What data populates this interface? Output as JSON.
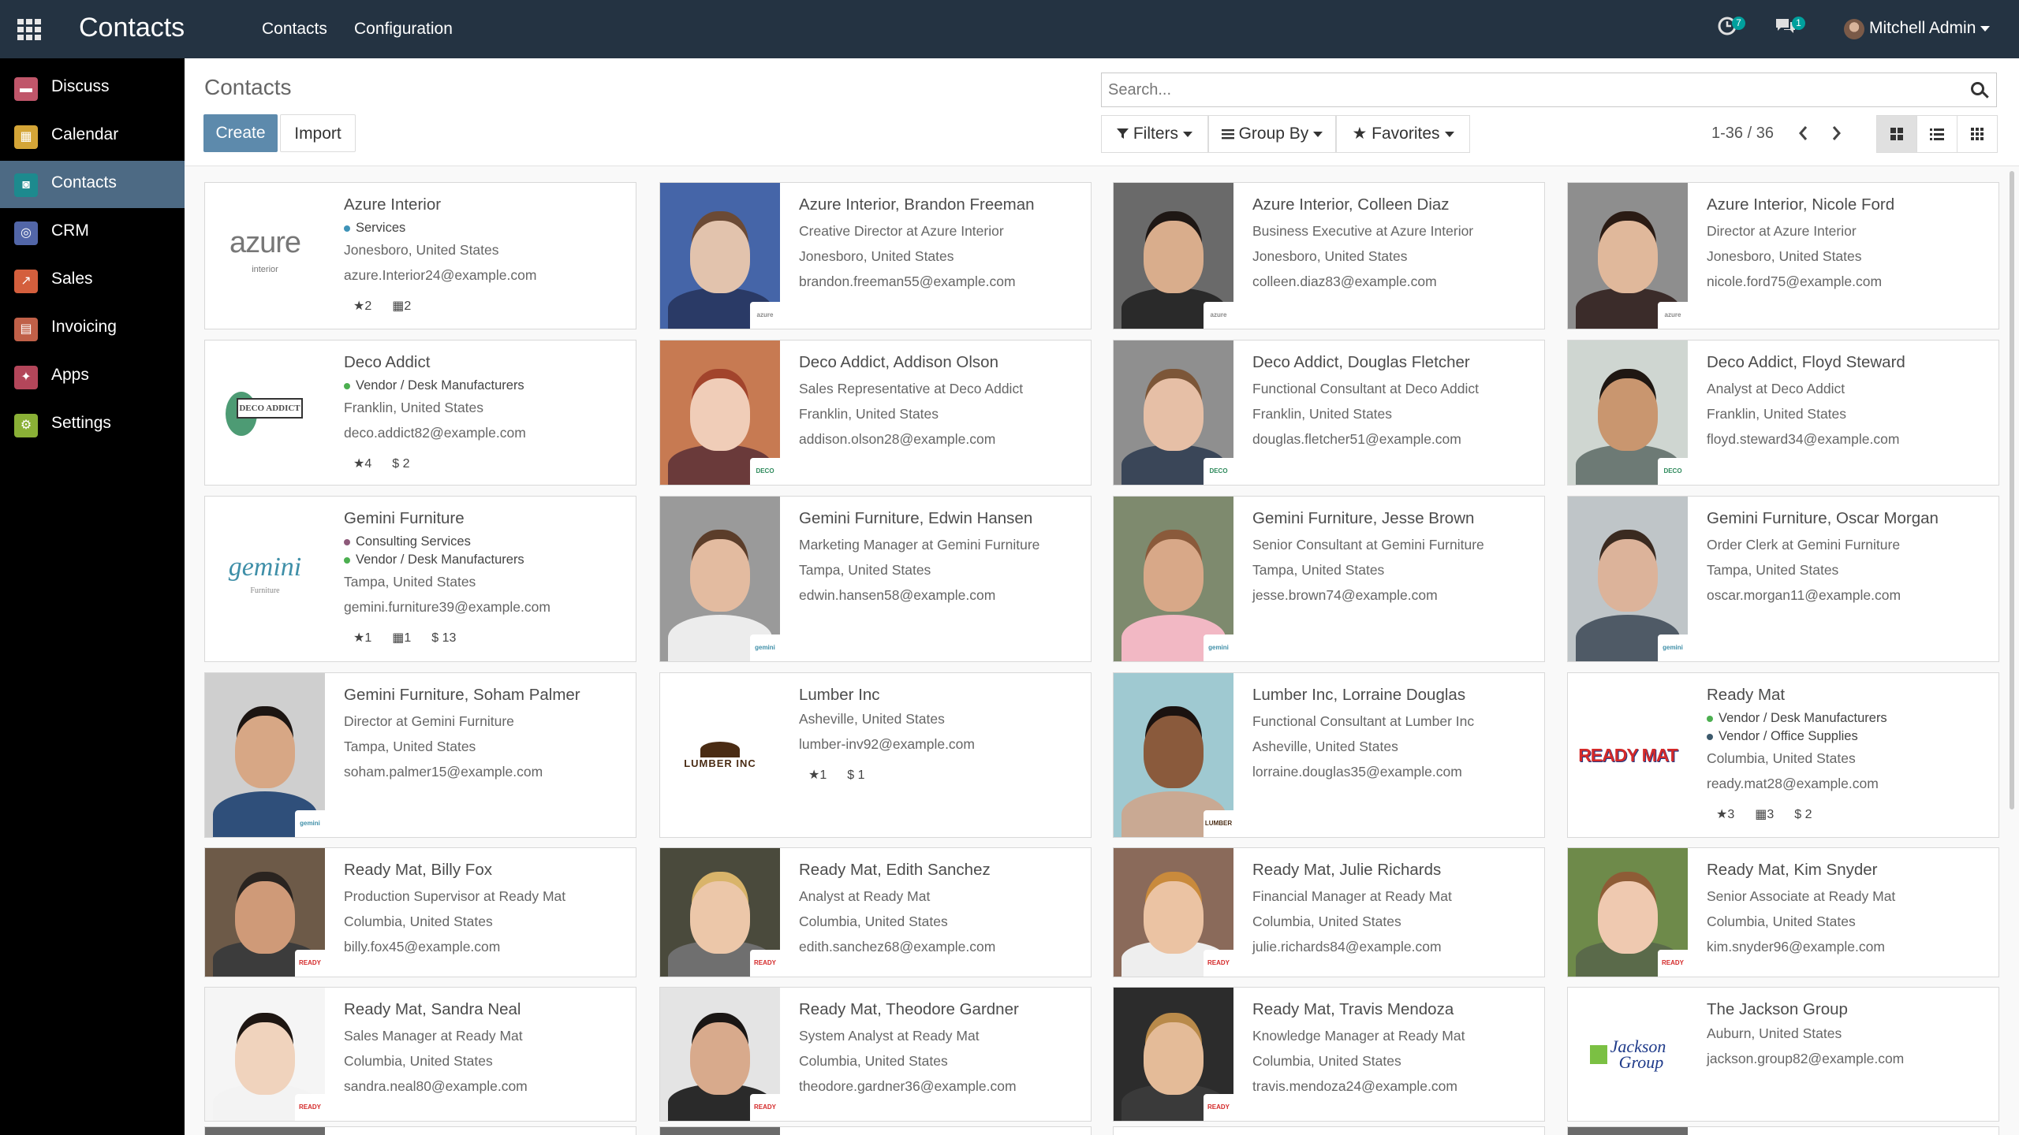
{
  "topbar": {
    "brand": "Contacts",
    "menu": [
      "Contacts",
      "Configuration"
    ],
    "activity_count": "7",
    "message_count": "1",
    "user_name": "Mitchell Admin",
    "bg_color": "#243342"
  },
  "sidebar": {
    "items": [
      {
        "label": "Discuss",
        "icon": "discuss-icon",
        "color": "#c0566a"
      },
      {
        "label": "Calendar",
        "icon": "calendar-icon",
        "color": "#d4a537"
      },
      {
        "label": "Contacts",
        "icon": "contacts-icon",
        "color": "#1d8a8e"
      },
      {
        "label": "CRM",
        "icon": "crm-icon",
        "color": "#5266a8"
      },
      {
        "label": "Sales",
        "icon": "sales-icon",
        "color": "#d45f3d"
      },
      {
        "label": "Invoicing",
        "icon": "invoicing-icon",
        "color": "#c06048"
      },
      {
        "label": "Apps",
        "icon": "apps-icon",
        "color": "#b3465a"
      },
      {
        "label": "Settings",
        "icon": "settings-icon",
        "color": "#8ab036"
      }
    ]
  },
  "control": {
    "title": "Contacts",
    "create_label": "Create",
    "import_label": "Import",
    "search_placeholder": "Search...",
    "filters_label": "Filters",
    "groupby_label": "Group By",
    "favorites_label": "Favorites",
    "pager": "1-36 / 36"
  },
  "cards": [
    {
      "name": "Azure Interior",
      "type": "company",
      "logo_text": "azure",
      "tags": [
        {
          "label": "Services",
          "color": "#3e93b8"
        }
      ],
      "lines": [
        "Jonesboro, United States",
        "azure.Interior24@example.com"
      ],
      "stats": [
        "★2",
        "▦2"
      ]
    },
    {
      "name": "Azure Interior, Brandon Freeman",
      "type": "person",
      "skin": "#e2c3ad",
      "hair": "#6b4a35",
      "shirt": "#2a3a66",
      "bg": "#4565a8",
      "badge": "azure",
      "lines": [
        "Creative Director at Azure Interior",
        "Jonesboro, United States",
        "brandon.freeman55@example.com"
      ]
    },
    {
      "name": "Azure Interior, Colleen Diaz",
      "type": "person",
      "skin": "#d9ad8c",
      "hair": "#1e1714",
      "shirt": "#2a2a2a",
      "bg": "#6a6a6a",
      "badge": "azure",
      "lines": [
        "Business Executive at Azure Interior",
        "Jonesboro, United States",
        "colleen.diaz83@example.com"
      ]
    },
    {
      "name": "Azure Interior, Nicole Ford",
      "type": "person",
      "skin": "#e0b89b",
      "hair": "#2a1b14",
      "shirt": "#3b2c2a",
      "bg": "#8e8e8e",
      "badge": "azure",
      "lines": [
        "Director at Azure Interior",
        "Jonesboro, United States",
        "nicole.ford75@example.com"
      ]
    },
    {
      "name": "Deco Addict",
      "type": "company",
      "logo_text": "DECO ADDICT",
      "tags": [
        {
          "label": "Vendor / Desk Manufacturers",
          "color": "#4caf50"
        }
      ],
      "lines": [
        "Franklin, United States",
        "deco.addict82@example.com"
      ],
      "stats": [
        "★4",
        "$ 2"
      ]
    },
    {
      "name": "Deco Addict, Addison Olson",
      "type": "person",
      "skin": "#f0cdb8",
      "hair": "#a2442c",
      "shirt": "#6a3a3a",
      "bg": "#c77a52",
      "badge": "deco",
      "lines": [
        "Sales Representative at Deco Addict",
        "Franklin, United States",
        "addison.olson28@example.com"
      ]
    },
    {
      "name": "Deco Addict, Douglas Fletcher",
      "type": "person",
      "skin": "#e6bfa6",
      "hair": "#7c5638",
      "shirt": "#3a4658",
      "bg": "#8f8f8f",
      "badge": "deco",
      "lines": [
        "Functional Consultant at Deco Addict",
        "Franklin, United States",
        "douglas.fletcher51@example.com"
      ]
    },
    {
      "name": "Deco Addict, Floyd Steward",
      "type": "person",
      "skin": "#c9966f",
      "hair": "#1f1712",
      "shirt": "#6d7a75",
      "bg": "#cfd6d1",
      "badge": "deco",
      "lines": [
        "Analyst at Deco Addict",
        "Franklin, United States",
        "floyd.steward34@example.com"
      ]
    },
    {
      "name": "Gemini Furniture",
      "type": "company",
      "logo_text": "gemini",
      "tags": [
        {
          "label": "Consulting Services",
          "color": "#8e5a7a"
        },
        {
          "label": "Vendor / Desk Manufacturers",
          "color": "#4caf50"
        }
      ],
      "lines": [
        "Tampa, United States",
        "gemini.furniture39@example.com"
      ],
      "stats": [
        "★1",
        "▦1",
        "$ 13"
      ]
    },
    {
      "name": "Gemini Furniture, Edwin Hansen",
      "type": "person",
      "skin": "#e3bba0",
      "hair": "#5b3d2a",
      "shirt": "#ececec",
      "bg": "#9a9a9a",
      "badge": "gemini",
      "lines": [
        "Marketing Manager at Gemini Furniture",
        "Tampa, United States",
        "edwin.hansen58@example.com"
      ]
    },
    {
      "name": "Gemini Furniture, Jesse Brown",
      "type": "person",
      "skin": "#d8a888",
      "hair": "#8a5a3b",
      "shirt": "#f2b8c4",
      "bg": "#7e8a6e",
      "badge": "gemini",
      "lines": [
        "Senior Consultant at Gemini Furniture",
        "Tampa, United States",
        "jesse.brown74@example.com"
      ]
    },
    {
      "name": "Gemini Furniture, Oscar Morgan",
      "type": "person",
      "skin": "#dcb39a",
      "hair": "#3a2a20",
      "shirt": "#4f5a66",
      "bg": "#bfc5c8",
      "badge": "gemini",
      "lines": [
        "Order Clerk at Gemini Furniture",
        "Tampa, United States",
        "oscar.morgan11@example.com"
      ]
    },
    {
      "name": "Gemini Furniture, Soham Palmer",
      "type": "person",
      "skin": "#d7a785",
      "hair": "#1c1512",
      "shirt": "#2f4f7a",
      "bg": "#cfcfcf",
      "badge": "gemini",
      "lines": [
        "Director at Gemini Furniture",
        "Tampa, United States",
        "soham.palmer15@example.com"
      ]
    },
    {
      "name": "Lumber Inc",
      "type": "company",
      "logo_text": "LUMBER INC",
      "tags": [],
      "lines": [
        "Asheville, United States",
        "lumber-inv92@example.com"
      ],
      "stats": [
        "★1",
        "$ 1"
      ]
    },
    {
      "name": "Lumber Inc, Lorraine Douglas",
      "type": "person",
      "skin": "#8a5a3c",
      "hair": "#1a1210",
      "shirt": "#c9a993",
      "bg": "#9fc9d1",
      "badge": "lumber",
      "lines": [
        "Functional Consultant at Lumber Inc",
        "Asheville, United States",
        "lorraine.douglas35@example.com"
      ]
    },
    {
      "name": "Ready Mat",
      "type": "company",
      "logo_text": "READY MAT",
      "tags": [
        {
          "label": "Vendor / Desk Manufacturers",
          "color": "#4caf50"
        },
        {
          "label": "Vendor / Office Supplies",
          "color": "#3d5a6c"
        }
      ],
      "lines": [
        "Columbia, United States",
        "ready.mat28@example.com"
      ],
      "stats": [
        "★3",
        "▦3",
        "$ 2"
      ]
    },
    {
      "name": "Ready Mat, Billy Fox",
      "type": "person",
      "skin": "#cf9a78",
      "hair": "#2a2420",
      "shirt": "#3c3c3c",
      "bg": "#6d5a48",
      "badge": "readymat",
      "lines": [
        "Production Supervisor at Ready Mat",
        "Columbia, United States",
        "billy.fox45@example.com"
      ]
    },
    {
      "name": "Ready Mat, Edith Sanchez",
      "type": "person",
      "skin": "#ecc7a9",
      "hair": "#d9b46a",
      "shirt": "#6f6f6f",
      "bg": "#4a4a3c",
      "badge": "readymat",
      "lines": [
        "Analyst at Ready Mat",
        "Columbia, United States",
        "edith.sanchez68@example.com"
      ]
    },
    {
      "name": "Ready Mat, Julie Richards",
      "type": "person",
      "skin": "#ebc3a3",
      "hair": "#c98a3c",
      "shirt": "#eeeeee",
      "bg": "#8a6a5a",
      "badge": "readymat",
      "lines": [
        "Financial Manager at Ready Mat",
        "Columbia, United States",
        "julie.richards84@example.com"
      ]
    },
    {
      "name": "Ready Mat, Kim Snyder",
      "type": "person",
      "skin": "#efc9b0",
      "hair": "#8e5c36",
      "shirt": "#5a6a4a",
      "bg": "#6e8a4a",
      "badge": "readymat",
      "lines": [
        "Senior Associate at Ready Mat",
        "Columbia, United States",
        "kim.snyder96@example.com"
      ]
    },
    {
      "name": "Ready Mat, Sandra Neal",
      "type": "person",
      "skin": "#f0d3bd",
      "hair": "#1e1612",
      "shirt": "#f3f3f3",
      "bg": "#f5f5f5",
      "badge": "readymat",
      "lines": [
        "Sales Manager at Ready Mat",
        "Columbia, United States",
        "sandra.neal80@example.com"
      ]
    },
    {
      "name": "Ready Mat, Theodore Gardner",
      "type": "person",
      "skin": "#d8aa8c",
      "hair": "#1a1614",
      "shirt": "#2a2a2a",
      "bg": "#e4e4e4",
      "badge": "readymat",
      "lines": [
        "System Analyst at Ready Mat",
        "Columbia, United States",
        "theodore.gardner36@example.com"
      ]
    },
    {
      "name": "Ready Mat, Travis Mendoza",
      "type": "person",
      "skin": "#e4bb98",
      "hair": "#b98a4a",
      "shirt": "#3a3a3a",
      "bg": "#2c2c2c",
      "badge": "readymat",
      "lines": [
        "Knowledge Manager at Ready Mat",
        "Columbia, United States",
        "travis.mendoza24@example.com"
      ]
    },
    {
      "name": "The Jackson Group",
      "type": "company",
      "logo_text": "Jackson Group",
      "tags": [],
      "lines": [
        "Auburn, United States",
        "jackson.group82@example.com"
      ],
      "stats": []
    }
  ]
}
